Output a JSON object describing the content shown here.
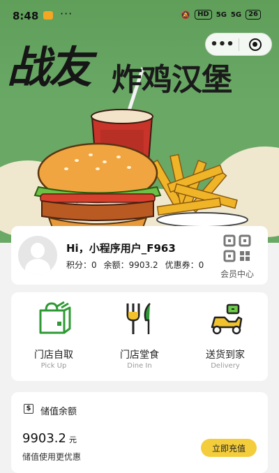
{
  "status_bar": {
    "time": "8:48",
    "more": "···",
    "hd": "HD",
    "signal_1": "5G",
    "signal_2": "5G",
    "battery": "26"
  },
  "capsule": {
    "menu": "•••"
  },
  "banner": {
    "title_big": "战友",
    "title_sub": "炸鸡汉堡"
  },
  "member": {
    "greeting": "Hi，小程序用户_F963",
    "points_label": "积分：0",
    "balance_label": "余额：9903.2",
    "coupon_label": "优惠券：0",
    "center_label": "会员中心"
  },
  "services": [
    {
      "label": "门店自取",
      "sub": "Pick Up",
      "icon": "bag-icon"
    },
    {
      "label": "门店堂食",
      "sub": "Dine In",
      "icon": "fork-knife-icon"
    },
    {
      "label": "送货到家",
      "sub": "Delivery",
      "icon": "scooter-icon"
    }
  ],
  "balance": {
    "title": "储值余额",
    "icon_glyph": "$",
    "amount": "9903.2",
    "unit": "元",
    "note": "储值使用更优惠",
    "button": "立即充值"
  },
  "colors": {
    "accent_green": "#3f9d3a",
    "accent_yellow": "#f4cd3c",
    "banner_green": "#6aa866"
  }
}
